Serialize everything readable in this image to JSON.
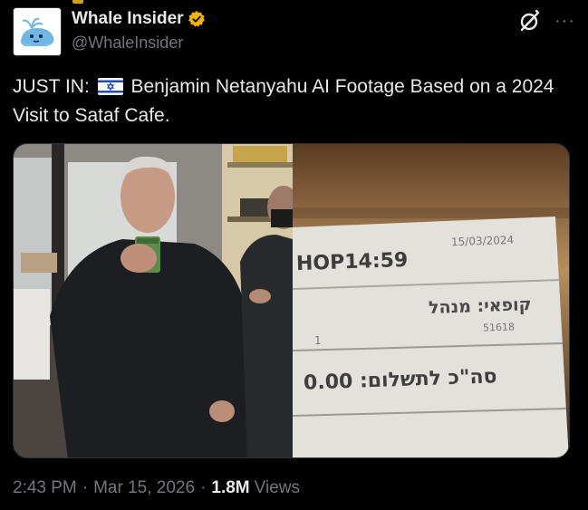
{
  "author": {
    "display_name": "Whale Insider",
    "handle": "@WhaleInsider",
    "verified": true,
    "verified_color": "#f4b400"
  },
  "header_icons": [
    "grok-icon",
    "more-icon"
  ],
  "tweet": {
    "text_prefix": "JUST IN:",
    "flag": "israel-flag-icon",
    "text_body": "Benjamin Netanyahu AI Footage Based on a 2024 Visit to Sataf Cafe."
  },
  "media": {
    "receipt_lines": {
      "shop_time": "HOP14:59",
      "date": "15/03/2024",
      "cashier": "קופאי: מנהל",
      "sub_number": "51618",
      "count": "1",
      "total_line": "סה\"כ לתשלום: 0.00"
    }
  },
  "meta": {
    "time": "2:43 PM",
    "date": "Mar 15, 2026",
    "views_count": "1.8M",
    "views_label": "Views",
    "separator": "·"
  },
  "colors": {
    "background": "#000000",
    "text": "#e7e9ea",
    "secondary": "#71767b",
    "border": "#2f3336"
  }
}
